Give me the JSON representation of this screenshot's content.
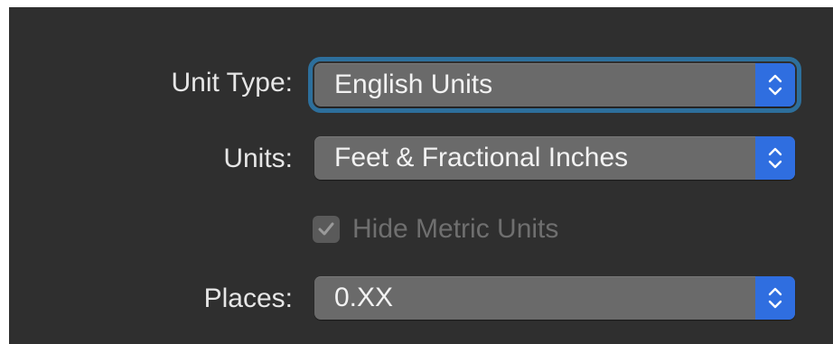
{
  "unit_type": {
    "label": "Unit Type:",
    "value": "English Units"
  },
  "units": {
    "label": "Units:",
    "value": "Feet & Fractional Inches"
  },
  "hide_metric": {
    "label": "Hide Metric Units",
    "checked": true,
    "enabled": false
  },
  "places": {
    "label": "Places:",
    "value": "0.XX"
  },
  "colors": {
    "panel_bg": "#2f2f2f",
    "popup_bg": "#6a6a6a",
    "accent_blue": "#2f6ee0",
    "focus_ring": "#2d6f9c"
  },
  "icons": {
    "popup_stepper": "chevron-up-down-icon",
    "checkbox_check": "checkmark-icon"
  }
}
